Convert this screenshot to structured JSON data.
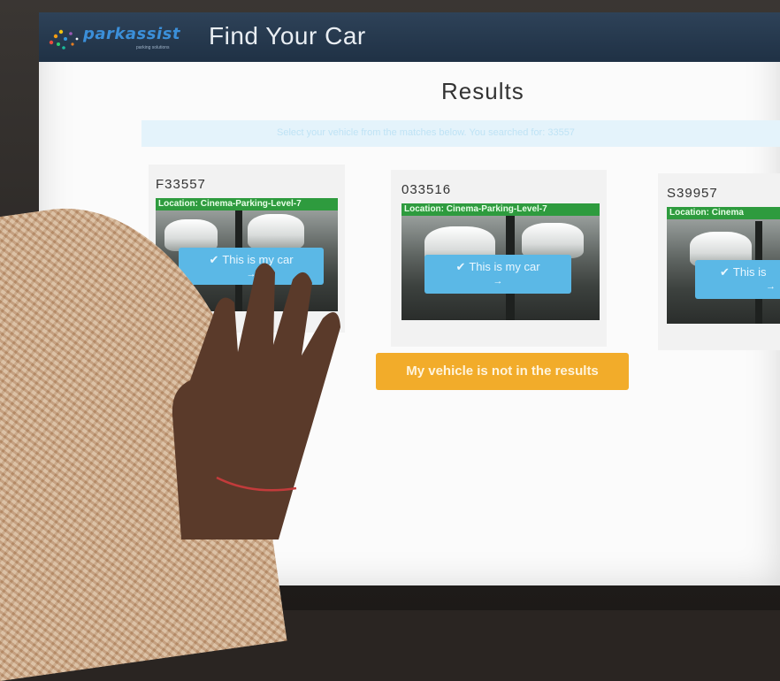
{
  "header": {
    "logo_text": "parkassist",
    "logo_sub": "parking solutions",
    "title": "Find Your Car"
  },
  "results": {
    "title": "Results",
    "instruction": "Select your vehicle from the matches below. You searched for: 33557"
  },
  "cards": [
    {
      "plate": "F33557",
      "location": "Location: Cinema-Parking-Level-7",
      "button": "This is my car",
      "arrow": "→"
    },
    {
      "plate": "033516",
      "location": "Location: Cinema-Parking-Level-7",
      "button": "This is my car",
      "arrow": "→"
    },
    {
      "plate": "S39957",
      "location": "Location: Cinema",
      "button": "This is",
      "arrow": "→"
    }
  ],
  "not_found_button": "My vehicle is not in the results",
  "colors": {
    "header_bg": "#2e4258",
    "location_banner": "#2e9b3e",
    "select_button": "#5bb8e6",
    "not_found_button": "#f2ac2a",
    "logo_blue": "#3b8fd9"
  }
}
